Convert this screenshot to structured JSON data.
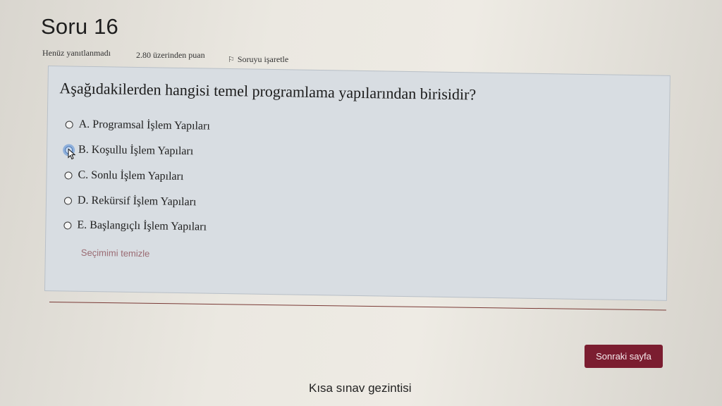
{
  "question": {
    "title": "Soru 16",
    "status": "Henüz yanıtlanmadı",
    "points": "2.80 üzerinden puan",
    "flag_label": "Soruyu işaretle",
    "text": "Aşağıdakilerden hangisi temel programlama yapılarından birisidir?",
    "options": [
      {
        "label": "A. Programsal İşlem Yapıları"
      },
      {
        "label": "B. Koşullu İşlem Yapıları"
      },
      {
        "label": "C. Sonlu İşlem Yapıları"
      },
      {
        "label": "D. Rekürsif İşlem Yapıları"
      },
      {
        "label": "E. Başlangıçlı İşlem Yapıları"
      }
    ],
    "clear_choice": "Seçimimi temizle"
  },
  "navigation": {
    "next_page": "Sonraki sayfa",
    "quiz_navigation": "Kısa sınav gezintisi"
  },
  "icons": {
    "flag": "flag-icon",
    "cursor": "mouse-pointer-icon"
  },
  "colors": {
    "question_box": "#d8dde2",
    "primary_button": "#7b1d30",
    "clear_link": "#9a6a72"
  }
}
